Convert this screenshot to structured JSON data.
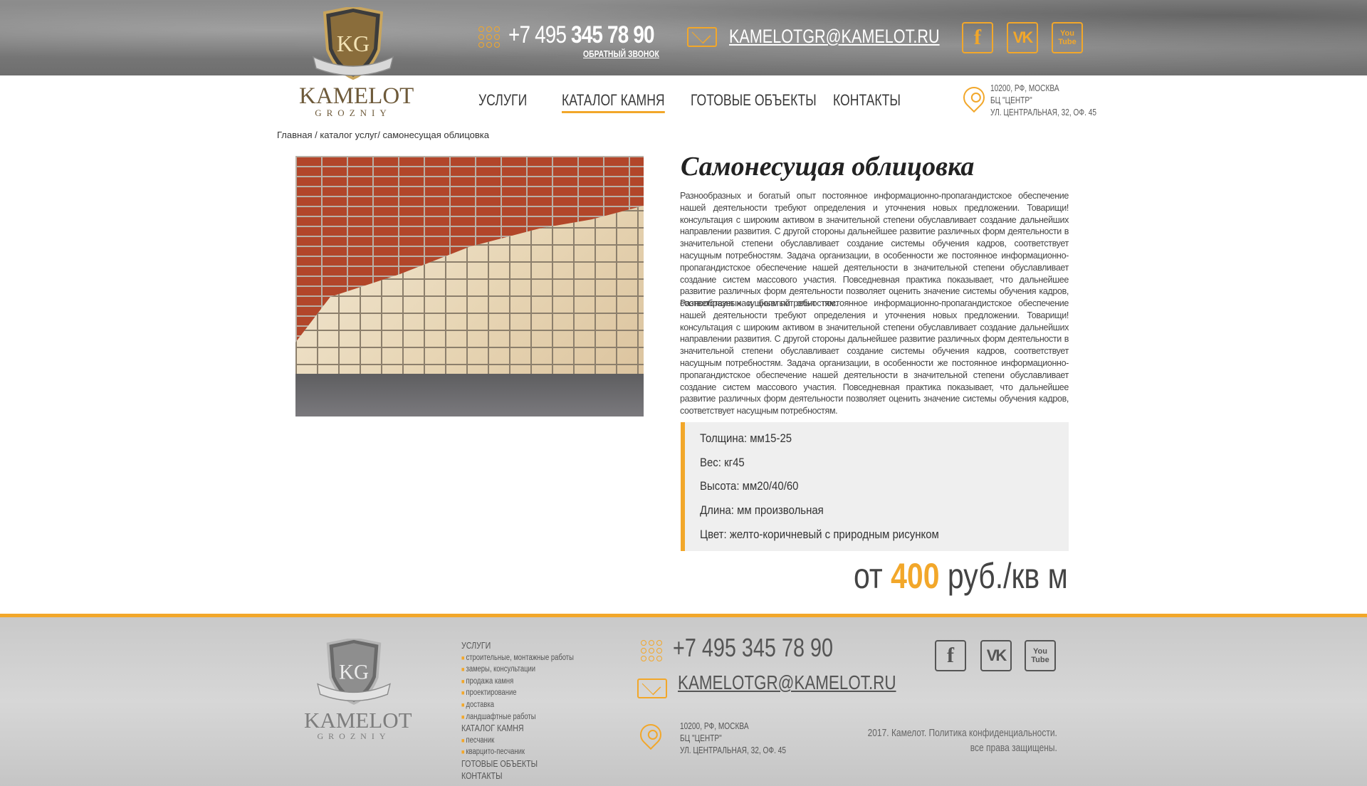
{
  "brand": {
    "name": "KAMELOT",
    "tagline": "GROZNIY",
    "monogram": "KG"
  },
  "header": {
    "phone_prefix": "+7 495 ",
    "phone_main": "345 78 90",
    "callback_label": "ОБРАТНЫЙ ЗВОНОК",
    "email": "KAMELOTGR@KAMELOT.RU",
    "social": [
      {
        "icon": "facebook-icon",
        "label": "f"
      },
      {
        "icon": "vk-icon",
        "label": "VK"
      },
      {
        "icon": "youtube-icon",
        "label": "You Tube"
      }
    ]
  },
  "nav": {
    "items": [
      {
        "label": "УСЛУГИ",
        "active": false
      },
      {
        "label": "КАТАЛОГ КАМНЯ",
        "active": true
      },
      {
        "label": "ГОТОВЫЕ ОБЪЕКТЫ",
        "active": false
      },
      {
        "label": "КОНТАКТЫ",
        "active": false
      }
    ]
  },
  "address": {
    "line1": "10200, РФ, МОСКВА",
    "line2": "БЦ \"ЦЕНТР\"",
    "line3": "УЛ. ЦЕНТРАЛЬНАЯ, 32, ОФ. 45"
  },
  "breadcrumb": "Главная / каталог услуг/ самонесущая облицовка",
  "product": {
    "title": "Самонесущая облицовка",
    "paragraphs": [
      "Разнообразных и богатый опыт постоянное информационно-пропагандистское обеспечение нашей деятельности требуют определения и уточнения новых предложении. Товарищи! консультация с широким активом в значительной степени обуславливает создание дальнейших направлении развития. С другой стороны дальнейшее развитие различных форм деятельности в значительной степени обуславливает создание системы обучения кадров, соответствует насущным потребностям. Задача организации, в особенности же постоянное информационно-пропагандистское обеспечение нашей деятельности в значительной степени обуславливает создание систем массового участия. Повседневная практика показывает, что дальнейшее развитие различных форм деятельности позволяет оценить значение системы обучения кадров, соответствует насущным потребностям.",
      "Разнообразных и богатый опыт постоянное информационно-пропагандистское обеспечение нашей деятельности требуют определения и уточнения новых предложении. Товарищи! консультация с широким активом в значительной степени обуславливает создание дальнейших направлении развития. С другой стороны дальнейшее развитие различных форм деятельности в значительной степени обуславливает создание системы обучения кадров, соответствует насущным потребностям. Задача организации, в особенности же постоянное информационно-пропагандистское обеспечение нашей деятельности в значительной степени обуславливает создание систем массового участия. Повседневная практика показывает, что дальнейшее развитие различных форм деятельности позволяет оценить значение системы обучения кадров, соответствует насущным потребностям."
    ],
    "specs": [
      "Толщина: мм15-25",
      "Вес: кг45",
      "Высота: мм20/40/60",
      "Длина: мм произвольная",
      "Цвет: желто-коричневый с природным рисунком"
    ],
    "price_prefix": "от ",
    "price_value": "400",
    "price_unit": " руб./кв м"
  },
  "footer": {
    "menu": [
      {
        "head": "УСЛУГИ",
        "items": [
          "строительные, монтажные работы",
          "замеры, консультации",
          "продажа камня",
          "проектирование",
          "доставка",
          "ландшафтные работы"
        ]
      },
      {
        "head": "КАТАЛОГ КАМНЯ",
        "items": [
          "песчаник",
          "кварцито-песчаник"
        ]
      },
      {
        "head": "ГОТОВЫЕ ОБЪЕКТЫ",
        "items": []
      },
      {
        "head": "КОНТАКТЫ",
        "items": []
      }
    ],
    "phone": "+7 495 345 78 90",
    "email": "KAMELOTGR@KAMELOT.RU",
    "address": {
      "line1": "10200, РФ, МОСКВА",
      "line2": "БЦ \"ЦЕНТР\"",
      "line3": "УЛ. ЦЕНТРАЛЬНАЯ, 32, ОФ. 45"
    },
    "copyright_line1": "2017. Камелот. Политика конфиденциальности.",
    "copyright_line2": "все права защищены."
  },
  "colors": {
    "accent": "#f2a72a",
    "text": "#333333",
    "footer_bg": "#d0d0d0"
  }
}
